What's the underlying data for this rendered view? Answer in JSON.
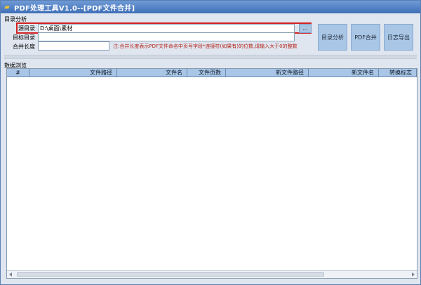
{
  "window": {
    "title": "PDF处理工具V1.0--[PDF文件合并]",
    "icon": "folder-icon"
  },
  "dir_section": {
    "group_label": "目录分析",
    "source_label": "源目录",
    "source_value": "D:\\桌面\\素材",
    "target_label": "目标目录",
    "target_value": "",
    "merge_label": "合并长度",
    "merge_value": "",
    "browse_label": "...",
    "note": "注:合并长度表示PDF文件命名中页号字段*连接符(如果有)的位数,请输入大于0的整数"
  },
  "actions": {
    "analyze": "目录分析",
    "merge": "PDF合并",
    "export_log": "日志导出"
  },
  "preview": {
    "group_label": "数据浏览",
    "columns": [
      "#",
      "文件路径",
      "文件名",
      "文件页数",
      "新文件路径",
      "新文件名",
      "转换标志"
    ]
  },
  "colors": {
    "titlebar": "#3f6fb8",
    "button_bg": "#a9c6e6",
    "highlight": "#d32222",
    "note_text": "#b5221a"
  }
}
